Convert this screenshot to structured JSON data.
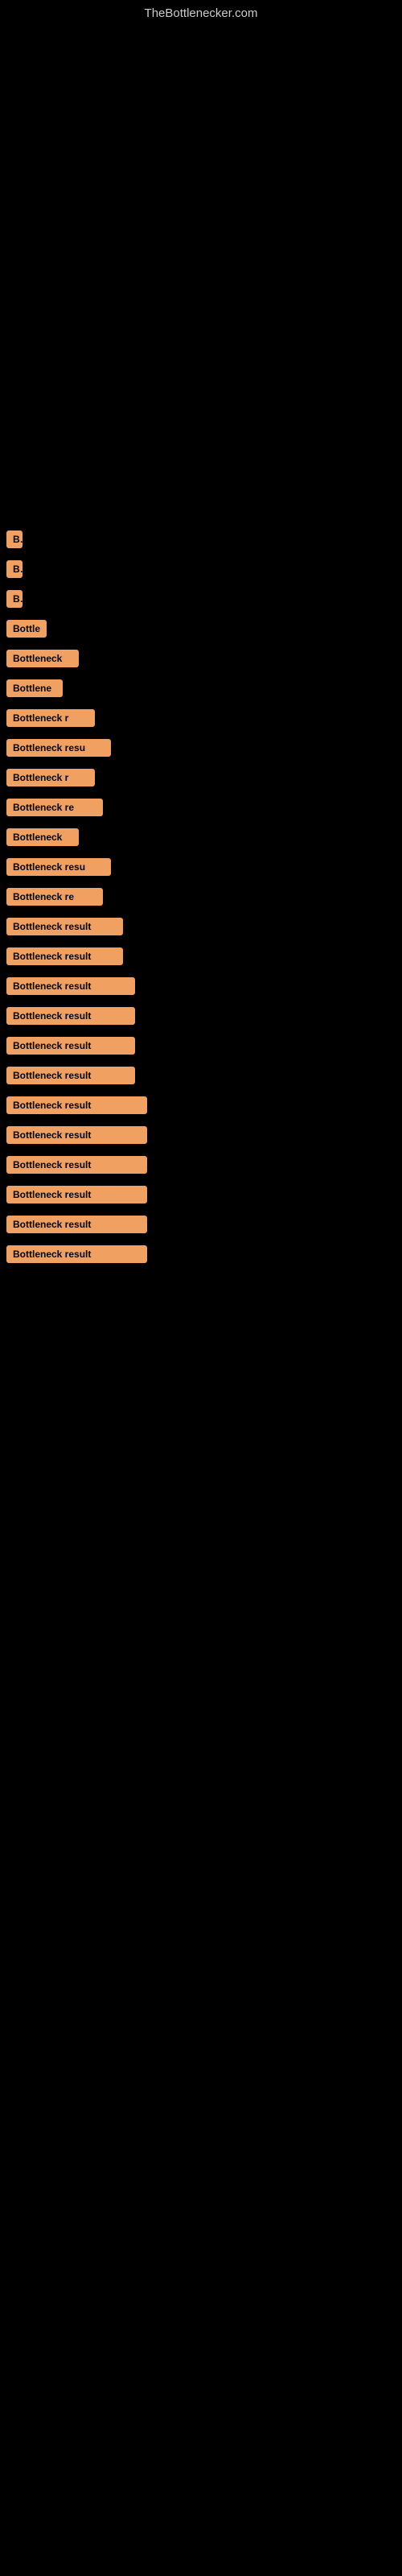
{
  "site": {
    "title": "TheBottlenecker.com"
  },
  "results": [
    {
      "label": "B",
      "width_class": "w-20"
    },
    {
      "label": "B",
      "width_class": "w-20"
    },
    {
      "label": "B",
      "width_class": "w-20"
    },
    {
      "label": "Bottle",
      "width_class": "w-50"
    },
    {
      "label": "Bottleneck",
      "width_class": "w-90"
    },
    {
      "label": "Bottlene",
      "width_class": "w-70"
    },
    {
      "label": "Bottleneck r",
      "width_class": "w-110"
    },
    {
      "label": "Bottleneck resu",
      "width_class": "w-130"
    },
    {
      "label": "Bottleneck r",
      "width_class": "w-110"
    },
    {
      "label": "Bottleneck re",
      "width_class": "w-120"
    },
    {
      "label": "Bottleneck",
      "width_class": "w-90"
    },
    {
      "label": "Bottleneck resu",
      "width_class": "w-130"
    },
    {
      "label": "Bottleneck re",
      "width_class": "w-120"
    },
    {
      "label": "Bottleneck result",
      "width_class": "w-145"
    },
    {
      "label": "Bottleneck result",
      "width_class": "w-145"
    },
    {
      "label": "Bottleneck result",
      "width_class": "w-160"
    },
    {
      "label": "Bottleneck result",
      "width_class": "w-160"
    },
    {
      "label": "Bottleneck result",
      "width_class": "w-160"
    },
    {
      "label": "Bottleneck result",
      "width_class": "w-160"
    },
    {
      "label": "Bottleneck result",
      "width_class": "w-175"
    },
    {
      "label": "Bottleneck result",
      "width_class": "w-175"
    },
    {
      "label": "Bottleneck result",
      "width_class": "w-175"
    },
    {
      "label": "Bottleneck result",
      "width_class": "w-175"
    },
    {
      "label": "Bottleneck result",
      "width_class": "w-175"
    },
    {
      "label": "Bottleneck result",
      "width_class": "w-175"
    }
  ]
}
